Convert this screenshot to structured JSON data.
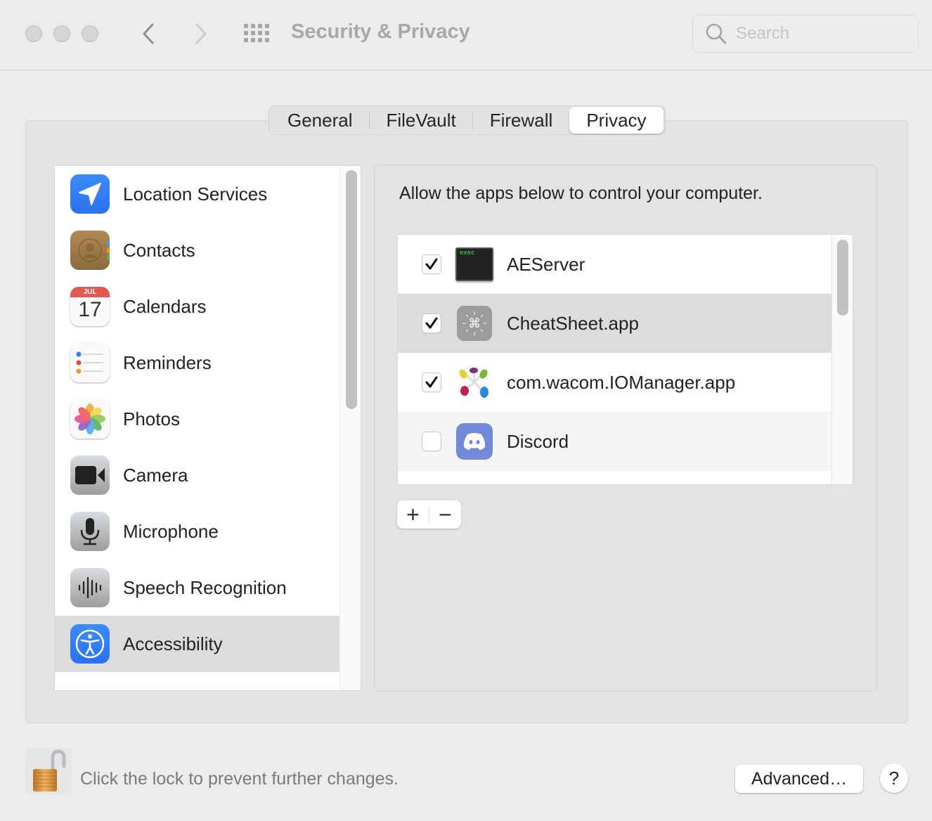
{
  "window": {
    "title": "Security & Privacy",
    "search_placeholder": "Search",
    "search_value": ""
  },
  "tabs": [
    {
      "label": "General",
      "active": false
    },
    {
      "label": "FileVault",
      "active": false
    },
    {
      "label": "Firewall",
      "active": false
    },
    {
      "label": "Privacy",
      "active": true
    }
  ],
  "sidebar": {
    "items": [
      {
        "label": "Location Services",
        "icon": "location-arrow-icon",
        "selected": false
      },
      {
        "label": "Contacts",
        "icon": "contacts-icon",
        "selected": false
      },
      {
        "label": "Calendars",
        "icon": "calendar-icon",
        "selected": false,
        "icon_month": "JUL",
        "icon_day": "17"
      },
      {
        "label": "Reminders",
        "icon": "reminders-icon",
        "selected": false
      },
      {
        "label": "Photos",
        "icon": "photos-icon",
        "selected": false
      },
      {
        "label": "Camera",
        "icon": "camera-icon",
        "selected": false
      },
      {
        "label": "Microphone",
        "icon": "microphone-icon",
        "selected": false
      },
      {
        "label": "Speech Recognition",
        "icon": "speech-waveform-icon",
        "selected": false
      },
      {
        "label": "Accessibility",
        "icon": "accessibility-icon",
        "selected": true
      }
    ]
  },
  "main": {
    "header": "Allow the apps below to control your computer.",
    "apps": [
      {
        "name": "AEServer",
        "checked": true,
        "icon": "terminal-exec-icon",
        "icon_text": "exec"
      },
      {
        "name": "CheatSheet.app",
        "checked": true,
        "icon": "cheatsheet-command-icon",
        "icon_text": "⌘",
        "selected": true
      },
      {
        "name": "com.wacom.IOManager.app",
        "checked": true,
        "icon": "wacom-icon"
      },
      {
        "name": "Discord",
        "checked": false,
        "icon": "discord-icon"
      },
      {
        "name": "",
        "checked": false,
        "icon": "generic-app-icon"
      }
    ],
    "add_label": "+",
    "remove_label": "−"
  },
  "footer": {
    "lock_text": "Click the lock to prevent further changes.",
    "advanced_label": "Advanced…",
    "help_label": "?"
  },
  "colors": {
    "accent_blue": "#2f7cf6",
    "selection_gray": "#dcdcdc",
    "window_bg": "#ececec",
    "panel_bg": "#e4e4e4"
  }
}
